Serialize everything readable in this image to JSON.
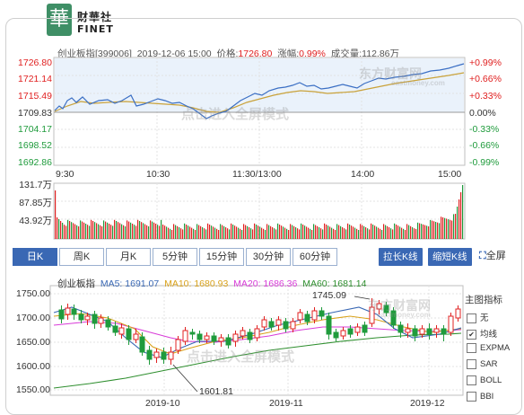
{
  "logo": {
    "seal": "華",
    "name_cn": "财華社",
    "name_en": "FINET"
  },
  "quote": {
    "name": "创业板指[399006]",
    "datetime": "2019-12-06 15:00",
    "price_label": "价格:",
    "price": "1726.80",
    "change_label": "涨幅:",
    "change": "0.99%",
    "volume_label": "成交量:",
    "volume": "112.86万"
  },
  "intraday": {
    "price_ticks": [
      "1726.80",
      "1721.14",
      "1715.49",
      "1709.83",
      "1704.17",
      "1698.52",
      "1692.86"
    ],
    "pct_ticks": [
      "+0.99%",
      "+0.66%",
      "+0.33%",
      "0.00%",
      "-0.33%",
      "-0.66%",
      "-0.99%"
    ],
    "time_ticks": [
      "9:30",
      "10:30",
      "11:30/13:00",
      "14:00",
      "15:00"
    ],
    "volume_ticks": [
      "131.7万",
      "87.85万",
      "43.92万"
    ],
    "watermark_logo": "东方财富网",
    "watermark_url": "eastmoney.com",
    "watermark_hint": "点击进入全屏模式"
  },
  "period_tabs": [
    "日K",
    "周K",
    "月K",
    "5分钟",
    "15分钟",
    "30分钟",
    "60分钟"
  ],
  "buttons": {
    "stretch": "拉长K线",
    "shrink": "缩短K线",
    "fullscreen": "全屏"
  },
  "kline": {
    "name": "创业板指",
    "ma5": "MA5: 1691.07",
    "ma10": "MA10: 1680.93",
    "ma20": "MA20: 1686.36",
    "ma60": "MA60: 1681.14",
    "price_ticks": [
      "1750.00",
      "1700.00",
      "1650.00",
      "1600.00",
      "1550.00"
    ],
    "date_ticks": [
      "2019-10",
      "2019-11",
      "2019-12"
    ],
    "high_label": "1745.09",
    "low_label": "1601.81",
    "watermark_logo": "东方财富网",
    "watermark_url": "eastmoney.com",
    "watermark_hint": "点击进入全屏模式"
  },
  "indicators": {
    "title": "主图指标",
    "items": [
      {
        "label": "无",
        "checked": false
      },
      {
        "label": "均线",
        "checked": true
      },
      {
        "label": "EXPMA",
        "checked": false
      },
      {
        "label": "SAR",
        "checked": false
      },
      {
        "label": "BOLL",
        "checked": false
      },
      {
        "label": "BBI",
        "checked": false
      }
    ]
  },
  "colors": {
    "up": "#e02020",
    "down": "#1f9b3c",
    "price_line": "#3b6fc4",
    "avg_line": "#c9a23a",
    "ma5": "#3a68b4",
    "ma10": "#d9a21b",
    "ma20": "#d83cd8",
    "ma60": "#2f8f2f",
    "tab_active": "#3a68b4"
  }
}
